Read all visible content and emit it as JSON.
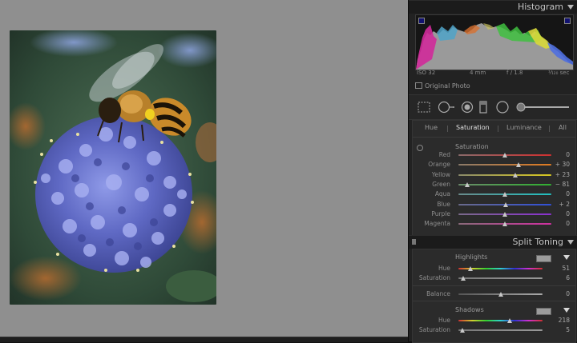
{
  "histogram": {
    "title": "Histogram",
    "exif": {
      "iso": "ISO 32",
      "focal": "4 mm",
      "aperture": "f / 1.8",
      "shutter": "¹⁄₁₂₀ sec"
    },
    "original_photo_label": "Original Photo"
  },
  "hsl": {
    "tabs": [
      "Hue",
      "Saturation",
      "Luminance",
      "All"
    ],
    "active_tab": "Saturation",
    "subsection_title": "Saturation",
    "rows": [
      {
        "label": "Red",
        "value": "0",
        "pos": 0.5
      },
      {
        "label": "Orange",
        "value": "+ 30",
        "pos": 0.65
      },
      {
        "label": "Yellow",
        "value": "+ 23",
        "pos": 0.615
      },
      {
        "label": "Green",
        "value": "− 81",
        "pos": 0.095
      },
      {
        "label": "Aqua",
        "value": "0",
        "pos": 0.5
      },
      {
        "label": "Blue",
        "value": "+ 2",
        "pos": 0.51
      },
      {
        "label": "Purple",
        "value": "0",
        "pos": 0.5
      },
      {
        "label": "Magenta",
        "value": "0",
        "pos": 0.5
      }
    ]
  },
  "split_toning": {
    "title": "Split Toning",
    "highlights": {
      "label": "Highlights",
      "hue_label": "Hue",
      "hue_value": "51",
      "hue_pos": 0.142,
      "sat_label": "Saturation",
      "sat_value": "6",
      "sat_pos": 0.06
    },
    "balance": {
      "label": "Balance",
      "value": "0",
      "pos": 0.5
    },
    "shadows": {
      "label": "Shadows",
      "hue_label": "Hue",
      "hue_value": "218",
      "hue_pos": 0.606,
      "sat_label": "Saturation",
      "sat_value": "5",
      "sat_pos": 0.05
    }
  },
  "colors": {
    "panel_bg": "#222222",
    "canvas_bg": "#8f8f8f",
    "accent_text": "#e0e0e0"
  }
}
